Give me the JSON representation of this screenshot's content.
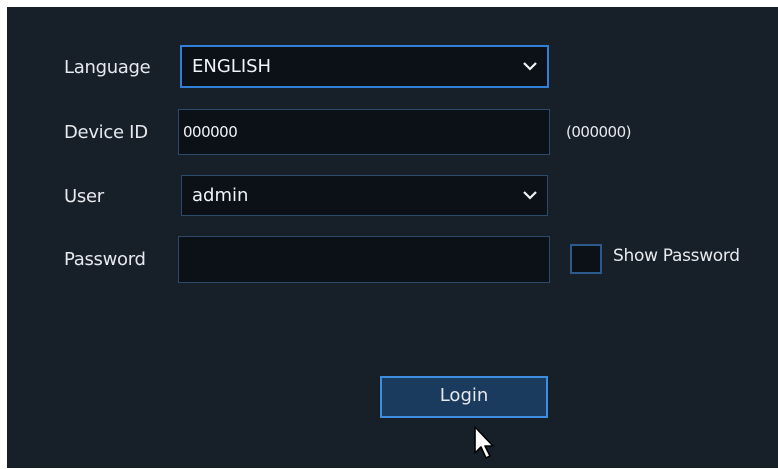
{
  "login_form": {
    "language": {
      "label": "Language",
      "value": "ENGLISH"
    },
    "device_id": {
      "label": "Device ID",
      "value": "000000",
      "hint": "(000000)"
    },
    "user": {
      "label": "User",
      "value": "admin"
    },
    "password": {
      "label": "Password",
      "value": "",
      "show_password_label": "Show Password",
      "show_password_checked": false
    },
    "login_button_label": "Login"
  },
  "colors": {
    "panel_background": "#172029",
    "field_background": "#0c1117",
    "field_border": "#2d4a6b",
    "focus_border": "#2f7fd8",
    "button_background": "#1a3a5e",
    "button_border": "#3d8de0",
    "text": "#e6e9ee"
  },
  "icons": {
    "dropdown": "chevron-down-icon",
    "pointer": "mouse-cursor-icon"
  }
}
